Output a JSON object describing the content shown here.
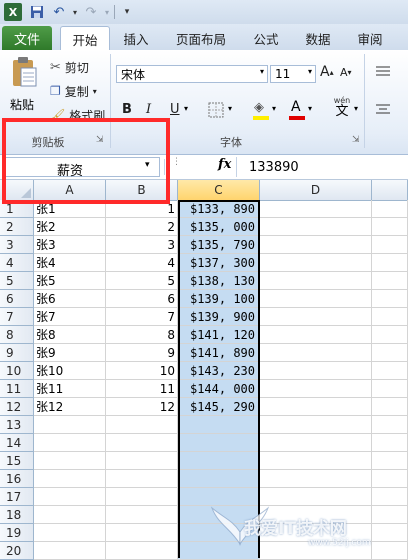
{
  "ribbon_tabs": [
    "文件",
    "开始",
    "插入",
    "页面布局",
    "公式",
    "数据",
    "审阅"
  ],
  "clipboard": {
    "paste": "粘贴",
    "cut": "剪切",
    "copy": "复制",
    "format_painter": "格式刷",
    "group_label": "剪贴板"
  },
  "font": {
    "name": "宋体",
    "size": "11",
    "group_label": "字体",
    "bold": "B",
    "italic": "I",
    "underline": "U",
    "grow": "A",
    "shrink": "A",
    "wen": "wén",
    "wen_char": "文"
  },
  "name_box": "薪资",
  "fx": "fx",
  "formula_value": "133890",
  "columns": [
    "A",
    "B",
    "C",
    "D"
  ],
  "rows": [
    {
      "n": "1",
      "a": "张1",
      "b": "1",
      "c": "$133, 890"
    },
    {
      "n": "2",
      "a": "张2",
      "b": "2",
      "c": "$135, 000"
    },
    {
      "n": "3",
      "a": "张3",
      "b": "3",
      "c": "$135, 790"
    },
    {
      "n": "4",
      "a": "张4",
      "b": "4",
      "c": "$137, 300"
    },
    {
      "n": "5",
      "a": "张5",
      "b": "5",
      "c": "$138, 130"
    },
    {
      "n": "6",
      "a": "张6",
      "b": "6",
      "c": "$139, 100"
    },
    {
      "n": "7",
      "a": "张7",
      "b": "7",
      "c": "$139, 900"
    },
    {
      "n": "8",
      "a": "张8",
      "b": "8",
      "c": "$141, 120"
    },
    {
      "n": "9",
      "a": "张9",
      "b": "9",
      "c": "$141, 890"
    },
    {
      "n": "10",
      "a": "张10",
      "b": "10",
      "c": "$143, 230"
    },
    {
      "n": "11",
      "a": "张11",
      "b": "11",
      "c": "$144, 000"
    },
    {
      "n": "12",
      "a": "张12",
      "b": "12",
      "c": "$145, 290"
    },
    {
      "n": "13",
      "a": "",
      "b": "",
      "c": ""
    },
    {
      "n": "14",
      "a": "",
      "b": "",
      "c": ""
    },
    {
      "n": "15",
      "a": "",
      "b": "",
      "c": ""
    },
    {
      "n": "16",
      "a": "",
      "b": "",
      "c": ""
    },
    {
      "n": "17",
      "a": "",
      "b": "",
      "c": ""
    },
    {
      "n": "18",
      "a": "",
      "b": "",
      "c": ""
    },
    {
      "n": "19",
      "a": "",
      "b": "",
      "c": ""
    },
    {
      "n": "20",
      "a": "",
      "b": "",
      "c": ""
    }
  ],
  "watermark": "我爱IT技术网",
  "watermark_url": "www.52ij.com",
  "colors": {
    "file_tab": "#2f7a2a",
    "selection": "#c5dcf2",
    "annotation": "#ff2a2a"
  }
}
